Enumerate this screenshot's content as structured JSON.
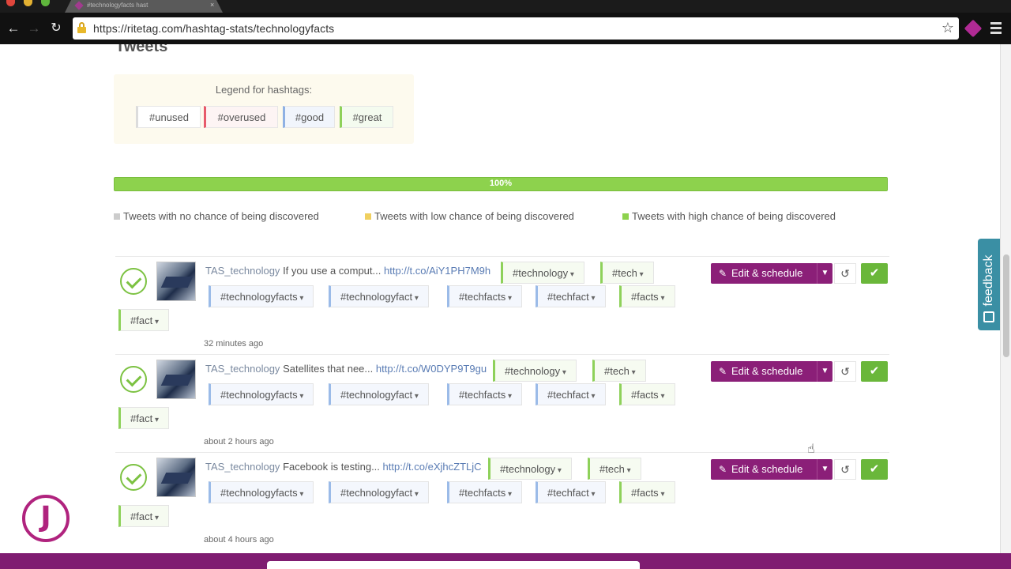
{
  "browser": {
    "tab_title": "#technologyfacts hast",
    "url": "https://ritetag.com/hashtag-stats/technologyfacts"
  },
  "section_title": "Tweets",
  "legend": {
    "title": "Legend for hashtags:",
    "items": [
      "#unused",
      "#overused",
      "#good",
      "#great"
    ]
  },
  "progress": {
    "value": 1.0,
    "label": "100%"
  },
  "status_legend": [
    {
      "label": "Tweets with no chance of being discovered",
      "color": "#cccccc"
    },
    {
      "label": "Tweets with low chance of being discovered",
      "color": "#f0d060"
    },
    {
      "label": "Tweets with high chance of being discovered",
      "color": "#8dd24d"
    }
  ],
  "tweets": [
    {
      "user": "TAS_technology",
      "text": "If you use a comput...",
      "link": "http://t.co/AiY1PH7M9h",
      "tags_row1": [
        "#technology",
        "#tech"
      ],
      "tags_row2": [
        "#technologyfacts",
        "#technologyfact",
        "#techfacts",
        "#techfact",
        "#facts"
      ],
      "tags_row3": [
        "#fact"
      ],
      "time": "32 minutes ago"
    },
    {
      "user": "TAS_technology",
      "text": "Satellites that nee...",
      "link": "http://t.co/W0DYP9T9gu",
      "tags_row1": [
        "#technology",
        "#tech"
      ],
      "tags_row2": [
        "#technologyfacts",
        "#technologyfact",
        "#techfacts",
        "#techfact",
        "#facts"
      ],
      "tags_row3": [
        "#fact"
      ],
      "time": "about 2 hours ago"
    },
    {
      "user": "TAS_technology",
      "text": "Facebook is testing...",
      "link": "http://t.co/eXjhcZTLjC",
      "tags_row1": [
        "#technology",
        "#tech"
      ],
      "tags_row2": [
        "#technologyfacts",
        "#technologyfact",
        "#techfacts",
        "#techfact",
        "#facts"
      ],
      "tags_row3": [
        "#fact"
      ],
      "time": "about 4 hours ago"
    }
  ],
  "actions": {
    "edit_schedule": "Edit & schedule"
  },
  "feedback": "feedback",
  "logo_letter": "J",
  "colors": {
    "brand": "#8b1f78",
    "great": "#8ed15a",
    "good": "#9bbbe8",
    "overused": "#e75a6b"
  }
}
